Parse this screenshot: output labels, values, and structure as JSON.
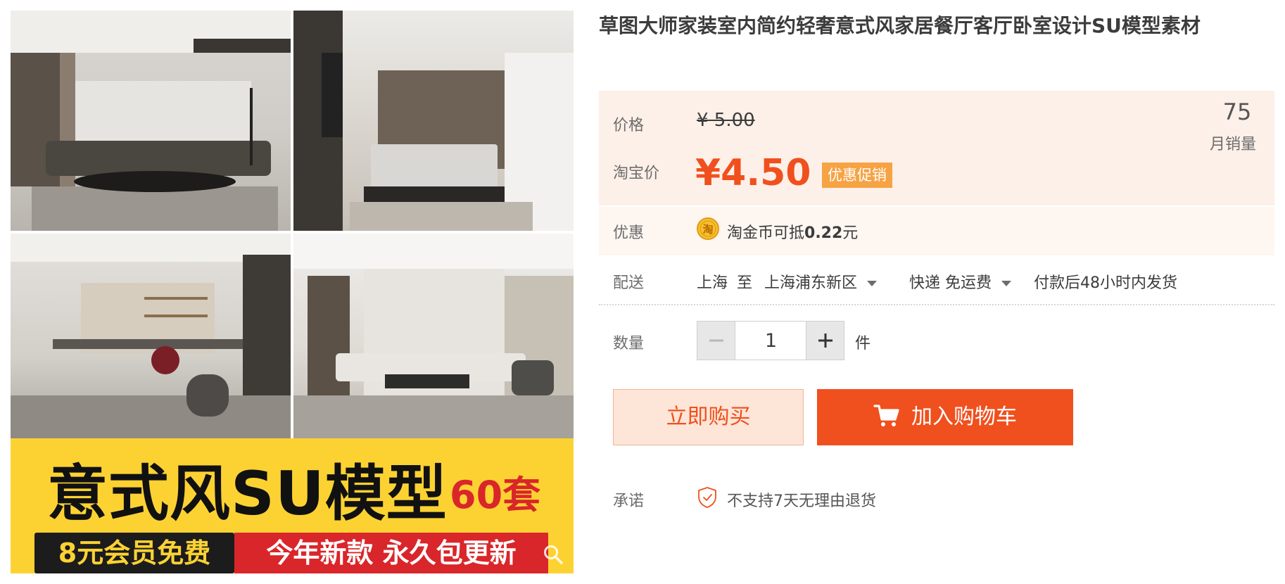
{
  "product": {
    "title": "草图大师家装室内简约轻奢意式风家居餐厅客厅卧室设计SU模型素材"
  },
  "gallery": {
    "banner_title": "意式风SU模型",
    "banner_count": "60套",
    "banner_left_text": "8元会员免费",
    "banner_right_text": "今年新款 永久包更新",
    "colors": {
      "banner_bg": "#fcd233",
      "banner_red": "#d9262a",
      "banner_dark": "#1c1c1c"
    }
  },
  "price": {
    "label": "价格",
    "original": "¥ 5.00",
    "taobao_label": "淘宝价",
    "sale": "¥4.50",
    "promo_tag": "优惠促销",
    "monthly_sales": "75",
    "monthly_sales_label": "月销量"
  },
  "promo": {
    "label": "优惠",
    "coin_text_prefix": "淘金币可抵",
    "coin_amount": "0.22",
    "coin_text_suffix": "元",
    "coin_icon_char": "淘"
  },
  "delivery": {
    "label": "配送",
    "from": "上海",
    "to_word": "至",
    "destination": "上海浦东新区",
    "method": "快递 免运费",
    "ship_time": "付款后48小时内发货"
  },
  "quantity": {
    "label": "数量",
    "value": "1",
    "unit": "件"
  },
  "actions": {
    "buy_now": "立即购买",
    "add_to_cart": "加入购物车"
  },
  "promise": {
    "label": "承诺",
    "text": "不支持7天无理由退货"
  },
  "colors": {
    "accent": "#f0501e",
    "price_bg": "#fdf0e8",
    "promo_tag": "#f6a344"
  }
}
